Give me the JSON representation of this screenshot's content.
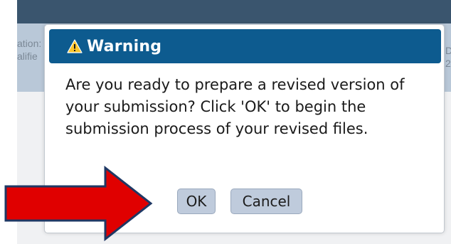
{
  "background": {
    "left_text_lines": [
      "ation:",
      "alifie"
    ],
    "right_text_lines": [
      "D",
      "2"
    ]
  },
  "dialog": {
    "icon": "warning-triangle-icon",
    "title": "Warning",
    "message": "Are you ready to prepare a revised version of your submission? Click 'OK' to begin the submission process of your revised files.",
    "ok_label": "OK",
    "cancel_label": "Cancel"
  },
  "annotation": {
    "icon": "red-arrow-right-icon",
    "color": "#e00000"
  },
  "colors": {
    "titlebar": "#0d5b8f",
    "warning_icon": "#ffc62a",
    "button": "#bfcbdc",
    "app_header": "#3a556e"
  }
}
